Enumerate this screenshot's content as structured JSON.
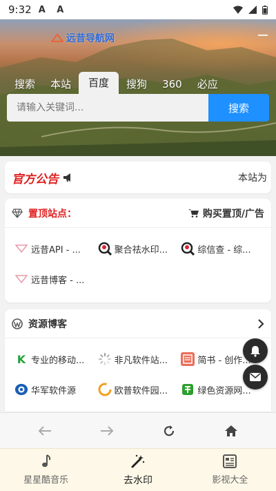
{
  "status_bar": {
    "time": "9:32",
    "left_icons": "A A"
  },
  "header": {
    "logo_text": "远昔导航网"
  },
  "search": {
    "engines": [
      "搜索",
      "本站",
      "百度",
      "搜狗",
      "360",
      "必应"
    ],
    "active_engine": "百度",
    "placeholder": "请输入关键词...",
    "button_label": "搜索"
  },
  "notice": {
    "title": "官方公告",
    "text": "本站为"
  },
  "top_sites": {
    "title": "置顶站点：",
    "buy_label": "购买置顶/广告",
    "items": [
      {
        "label": "远昔API - ...",
        "icon": "yuanxi-logo-icon"
      },
      {
        "label": "聚合祛水印...",
        "icon": "magnifier-avatar-icon"
      },
      {
        "label": "综信查 - 综...",
        "icon": "magnifier-avatar-icon"
      },
      {
        "label": "远昔博客 - ...",
        "icon": "yuanxi-logo-icon"
      }
    ]
  },
  "resources": {
    "title": "资源博客",
    "items": [
      {
        "label": "专业的移动...",
        "icon": "k-letter-icon"
      },
      {
        "label": "非凡软件站...",
        "icon": "loading-spinner-icon"
      },
      {
        "label": "简书 - 创作...",
        "icon": "jianshu-icon"
      },
      {
        "label": "华军软件源",
        "icon": "huajun-logo-icon"
      },
      {
        "label": "欧普软件园...",
        "icon": "ring-logo-icon"
      },
      {
        "label": "绿色资源网...",
        "icon": "green-char-icon"
      }
    ]
  },
  "bottom_tabs": [
    {
      "label": "星星酷音乐",
      "icon": "music-note-icon",
      "active": false
    },
    {
      "label": "去水印",
      "icon": "magic-wand-icon",
      "active": true
    },
    {
      "label": "影视大全",
      "icon": "film-list-icon",
      "active": false
    }
  ],
  "colors": {
    "accent": "#1e90ff",
    "notice_red": "#e02020",
    "tabbar_bg": "#fdf8e7"
  }
}
